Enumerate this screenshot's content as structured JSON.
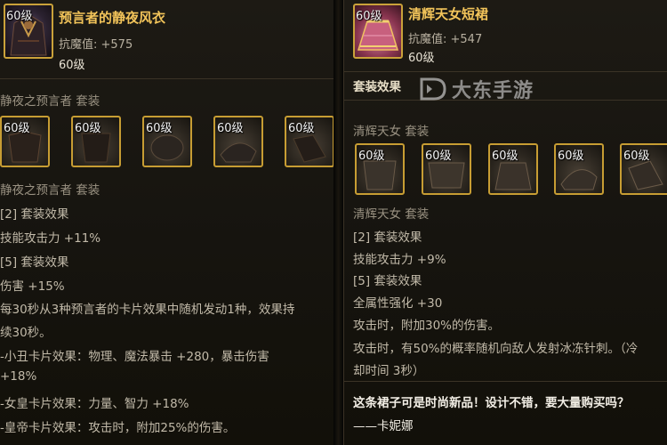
{
  "left": {
    "item": {
      "level": "60级",
      "name": "预言者的静夜风衣",
      "stat": "抗魔值: +575",
      "req_level": "60级"
    },
    "set_header": "静夜之预言者  套装",
    "set_slots": [
      "60级",
      "60级",
      "60级",
      "60级",
      "60级"
    ],
    "set_name": "静夜之预言者  套装",
    "lines": [
      "[2] 套装效果",
      "技能攻击力 +11%",
      "[5] 套装效果",
      "伤害 +15%",
      "每30秒从3种预言者的卡片效果中随机发动1种，效果持",
      "续30秒。",
      "-小丑卡片效果：物理、魔法暴击 +280，暴击伤害",
      "+18%",
      "-女皇卡片效果：力量、智力 +18%",
      "-皇帝卡片效果：攻击时，附加25%的伤害。"
    ]
  },
  "right": {
    "item": {
      "level": "60级",
      "name": "清辉天女短裙",
      "stat": "抗魔值: +547",
      "req_level": "60级"
    },
    "set_effect_label": "套装效果",
    "set_header": "清辉天女  套装",
    "set_slots": [
      "60级",
      "60级",
      "60级",
      "60级",
      "60级"
    ],
    "set_name": "清辉天女  套装",
    "lines": [
      "[2] 套装效果",
      "技能攻击力 +9%",
      "[5] 套装效果",
      "全属性强化 +30",
      "攻击时，附加30%的伤害。",
      "攻击时，有50%的概率随机向敌人发射冰冻针刺。（冷",
      "却时间 3秒）"
    ],
    "quote": "这条裙子可是时尚新品！设计不错，要大量购买吗？",
    "quote_author": "——卡妮娜"
  },
  "watermark": "大东手游",
  "colors": {
    "gold": "#f2c45a",
    "border": "#c79d33",
    "text": "#c2baa9"
  }
}
